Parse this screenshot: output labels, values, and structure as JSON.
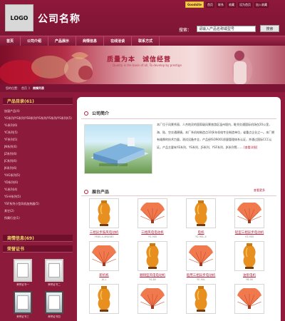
{
  "header": {
    "logo": "LOGO",
    "company_name": "公司名称",
    "top_links": [
      "Goodsite",
      "首页",
      "联系",
      "收藏",
      "设为首页",
      "加入收藏"
    ],
    "search_label": "搜索：",
    "search_value": "请输入产品名称或型号",
    "search_button": "搜索"
  },
  "nav": [
    "首页",
    "公司介绍",
    "产品展示",
    "商情信息",
    "在线洽谈",
    "联系方式"
  ],
  "banner": {
    "slogan": "质量为本　诚信经营",
    "slogan_en": "Quality is the basis of all, To develop by prestige"
  },
  "breadcrumb": {
    "items": [
      "您的位置：",
      "首页",
      "》"
    ],
    "current": "商情列表"
  },
  "sidebar": {
    "product_head": "产品目录(61)",
    "categories": [
      "加湿产品(4)",
      "YG系列/YS系列/YS8系列/YS系列/YS系列/YS系列/(5)",
      "YL系列(6)",
      "YC系列(5)",
      "YF系列(5)",
      "JN系列(6)",
      "JZ系列(6)",
      "JC系列(6)",
      "JK系列(6)",
      "YUG系列(5)",
      "YD系列(6)",
      "YL系列(4)",
      "YS-H系列(5)",
      "YSF系列小型风机加热器(5)",
      "其它(2)",
      "所属行业(1)"
    ],
    "news_head": "商情信息(69)",
    "cert_head": "荣誉证书",
    "certs": [
      "荣誉证书一",
      "荣誉证书二",
      "荣誉证书三",
      "荣誉证书四"
    ]
  },
  "intro": {
    "title": "公司简介",
    "text": "本厂位于风景秀丽、人杰地灵的国家级风景旅游区温州境内，毗邻交通国际机场仅20公里，海、陆、空交通便捷。本厂系机电制造点10多年机电专业制造单位，省重点企业之一。本厂拥有雄厚的技术力量，测试设备齐全，产品经ISO9001质量管理体系认证，并通过国际CCC认证。产品主要有YE系列、YS系列、JS系列、YSF系列、JK系列等……",
    "more": "[查看详细]"
  },
  "products": {
    "title": "展台产品",
    "more": "查看更多",
    "items": [
      {
        "name": "三相异步鼓风电动机",
        "code": "YE80-4-4KW-B3"
      },
      {
        "name": "三相风电电动机",
        "code": "YS-90S"
      },
      {
        "name": "电机",
        "code": "Y2-90L-4"
      },
      {
        "name": "轻型三相异步电动机",
        "code": "YZ-90S"
      },
      {
        "name": "新机机",
        "code": "JK-1"
      },
      {
        "name": "顺翔型风电电动机",
        "code": "YS-80"
      },
      {
        "name": "船用三相异步电动机",
        "code": "YE-90L"
      },
      {
        "name": "油泵电机",
        "code": "YB-90"
      },
      {
        "name": "",
        "code": ""
      },
      {
        "name": "",
        "code": ""
      },
      {
        "name": "",
        "code": ""
      },
      {
        "name": "",
        "code": ""
      }
    ]
  },
  "colors": {
    "brand": "#8f1a3c",
    "accent": "#b3233e",
    "highlight": "#f2d04c"
  }
}
